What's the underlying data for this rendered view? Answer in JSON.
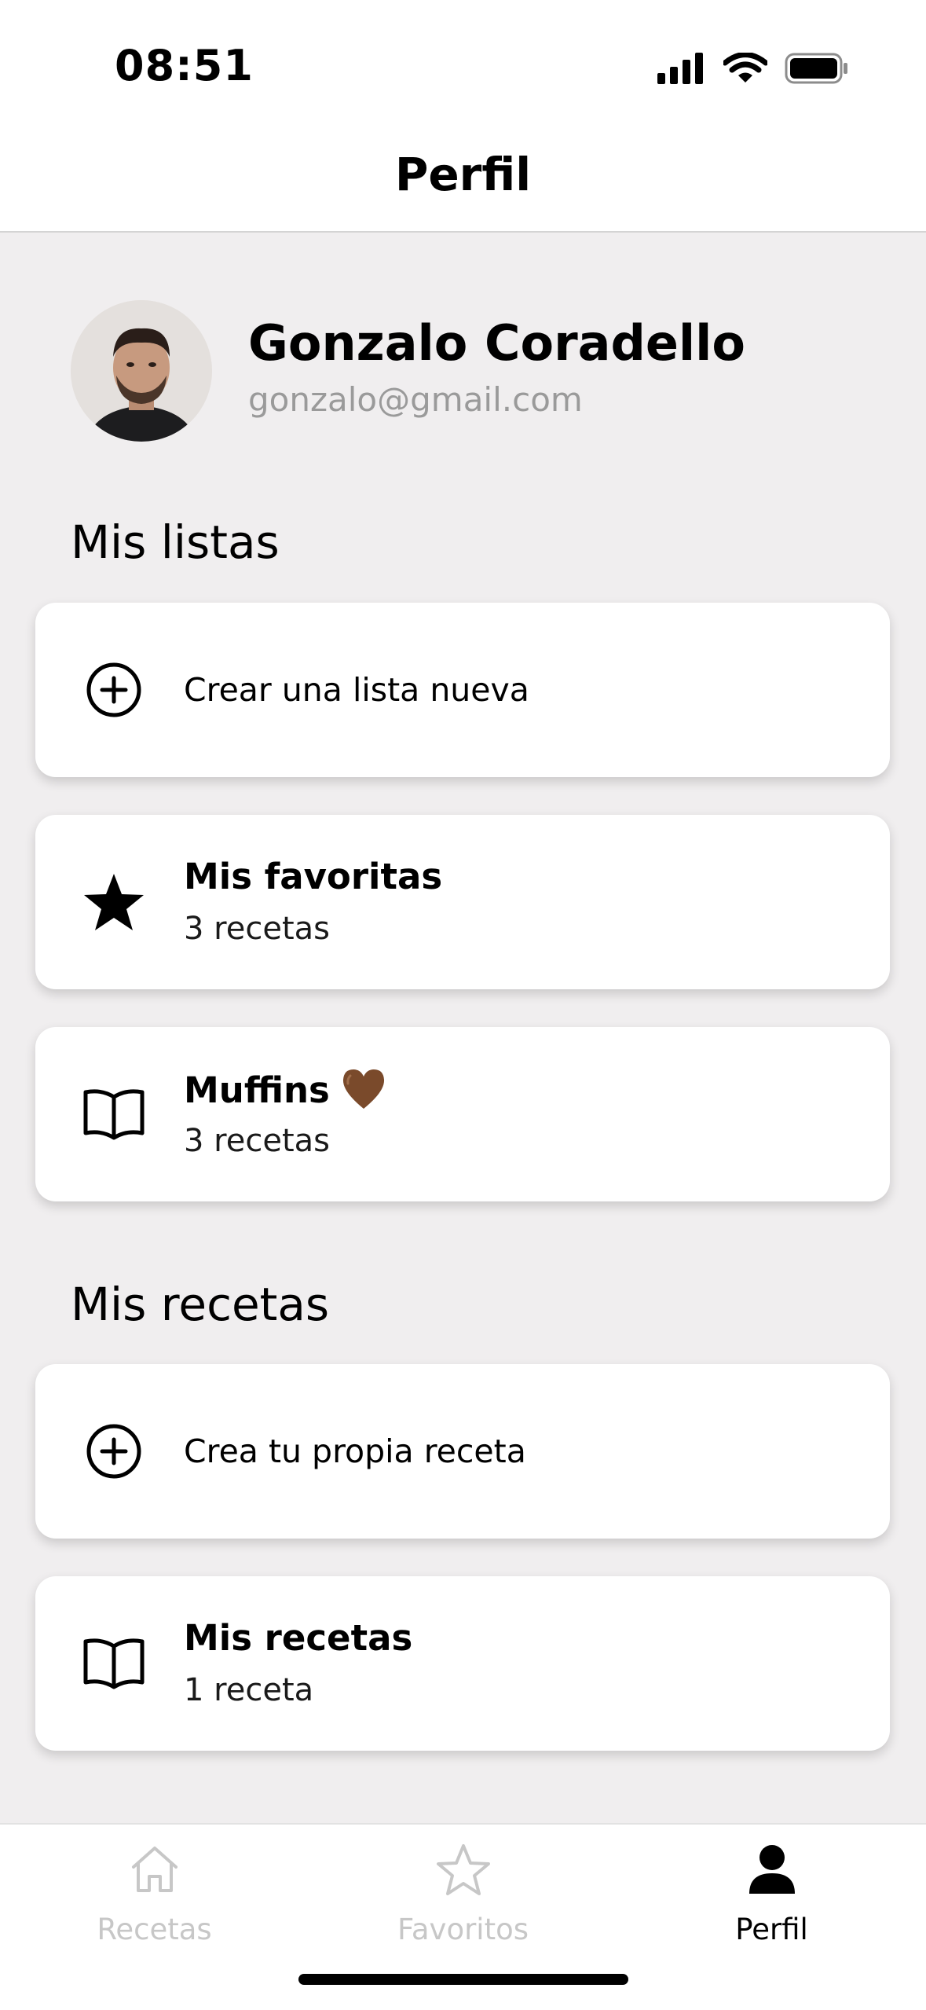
{
  "status_bar": {
    "time": "08:51"
  },
  "header": {
    "title": "Perfil"
  },
  "profile": {
    "name": "Gonzalo Coradello",
    "email": "gonzalo@gmail.com"
  },
  "lists": {
    "title": "Mis listas",
    "create_label": "Crear una lista nueva",
    "items": [
      {
        "title": "Mis favoritas",
        "count": "3 recetas",
        "icon": "star-icon"
      },
      {
        "title": "Muffins",
        "count": "3 recetas",
        "icon": "book-icon",
        "emoji": "brown-heart-icon"
      }
    ]
  },
  "recipes": {
    "title": "Mis recetas",
    "create_label": "Crea tu propia receta",
    "items": [
      {
        "title": "Mis recetas",
        "count": "1 receta",
        "icon": "book-icon"
      }
    ]
  },
  "tab_bar": {
    "tabs": [
      {
        "label": "Recetas",
        "icon": "home-icon",
        "active": false
      },
      {
        "label": "Favoritos",
        "icon": "star-outline-icon",
        "active": false
      },
      {
        "label": "Perfil",
        "icon": "person-icon",
        "active": true
      }
    ]
  },
  "colors": {
    "background": "#f0eeef",
    "card": "#ffffff",
    "inactive_tab": "#c7c7c7",
    "email": "#9a9a9a",
    "heart": "#7a4a2b"
  }
}
